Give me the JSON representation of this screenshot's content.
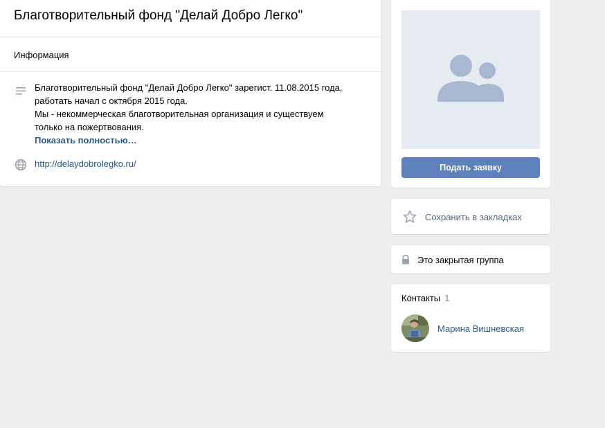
{
  "group": {
    "title": "Благотворительный фонд \"Делай Добро Легко\""
  },
  "info": {
    "header": "Информация",
    "description_lines": [
      "Благотворительный фонд \"Делай Добро Легко\" зарегист. 11.08.2015 года,",
      "работать начал с октября 2015 года.",
      "Мы - некоммерческая благотворительная организация и существуем",
      "только на пожертвования."
    ],
    "show_more": "Показать полностью…",
    "website": "http://delaydobrolegko.ru/"
  },
  "sidebar": {
    "join_button": "Подать заявку",
    "bookmark_label": "Сохранить в закладках",
    "closed_group_label": "Это закрытая группа",
    "contacts": {
      "title": "Контакты",
      "count": "1",
      "items": [
        {
          "name": "Марина Вишневская"
        }
      ]
    }
  },
  "icons": {
    "description": "lines-icon",
    "website": "globe-icon",
    "avatar_placeholder": "users-icon",
    "bookmark": "star-icon",
    "closed": "lock-icon"
  },
  "colors": {
    "background": "#edeef0",
    "link": "#2a5885",
    "button": "#5e81bd",
    "avatar_placeholder_bg": "#e5ebf1",
    "avatar_placeholder_icon": "#a9b8d1",
    "icon_gray": "#99a2ad"
  }
}
